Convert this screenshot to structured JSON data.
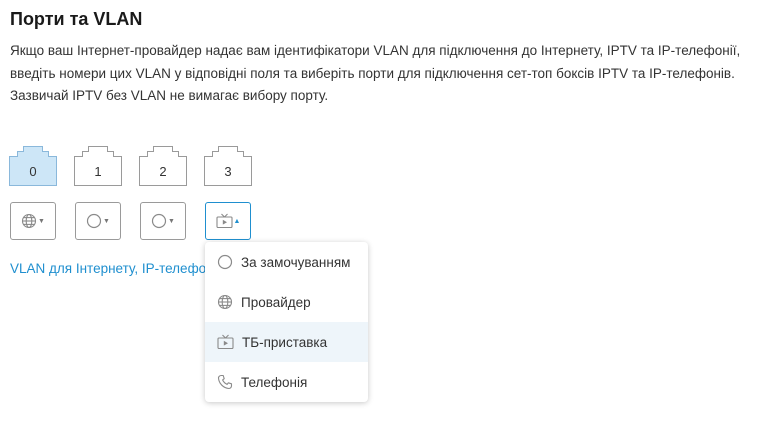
{
  "page": {
    "title": "Порти та VLAN",
    "description": "Якщо ваш Інтернет-провайдер надає вам ідентифікатори VLAN для підключення до Інтернету, IPTV та IP-телефонії, введіть номери цих VLAN у відповідні поля та виберіть порти для підключення сет-топ боксів IPTV та IP-телефонів. Зазвичай IPTV без VLAN не вимагає вибору порту."
  },
  "ports": [
    {
      "label": "0",
      "active": true,
      "mode_icon": "globe-icon"
    },
    {
      "label": "1",
      "active": false,
      "mode_icon": "circle-icon"
    },
    {
      "label": "2",
      "active": false,
      "mode_icon": "circle-icon"
    },
    {
      "label": "3",
      "active": false,
      "mode_icon": "tv-icon"
    }
  ],
  "link_text": "VLAN для Інтернету, IP-телефонії",
  "dropdown": {
    "items": [
      {
        "label": "За замочуванням",
        "icon": "circle-icon"
      },
      {
        "label": "Провайдер",
        "icon": "globe-icon"
      },
      {
        "label": "ТБ-приставка",
        "icon": "tv-icon"
      },
      {
        "label": "Телефонія",
        "icon": "phone-icon"
      }
    ],
    "selected_index": 2
  },
  "colors": {
    "accent": "#1f8fcf",
    "port_active_fill": "#cde6f7",
    "port_active_stroke": "#8ab8db",
    "menu_selected_bg": "#eef5fa"
  }
}
